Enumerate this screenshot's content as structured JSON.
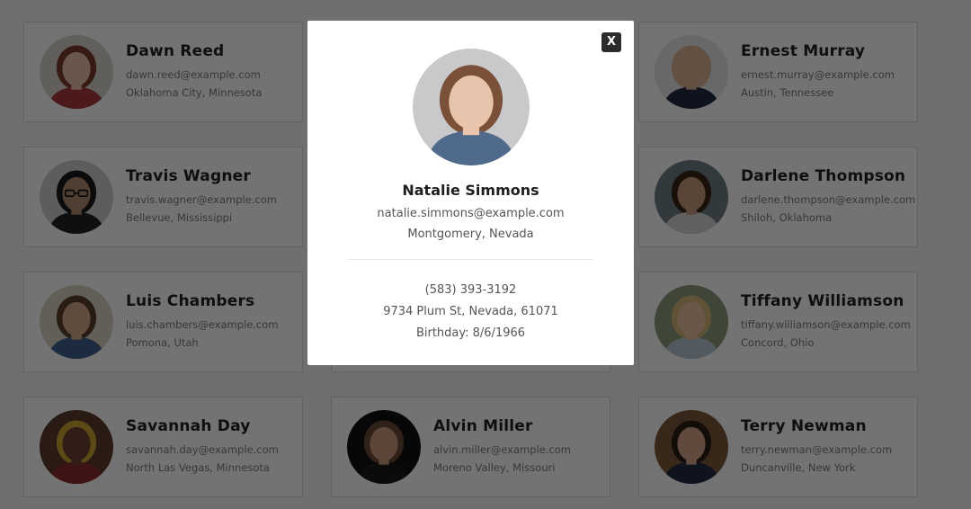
{
  "users": [
    {
      "name": "Dawn Reed",
      "email": "dawn.reed@example.com",
      "location": "Oklahoma City, Minnesota",
      "avatar": "woman-portrait",
      "bg": "#d8d2cc",
      "skin": "#e8c2a8",
      "hair": "#7a3b2a",
      "cloth": "#a83a3a"
    },
    {
      "name": "",
      "email": "",
      "location": "",
      "avatar": "hidden",
      "bg": "#dddddd",
      "skin": "#cccccc",
      "hair": "#999999",
      "cloth": "#aaaaaa"
    },
    {
      "name": "Ernest Murray",
      "email": "ernest.murray@example.com",
      "location": "Austin, Tennessee",
      "avatar": "man-portrait",
      "bg": "#e6e6e6",
      "skin": "#d9b196",
      "hair": "#d9b196",
      "cloth": "#1f2c44"
    },
    {
      "name": "Travis Wagner",
      "email": "travis.wagner@example.com",
      "location": "Bellevue, Mississippi",
      "avatar": "man-glasses-portrait",
      "bg": "#cfcfcf",
      "skin": "#b08a70",
      "hair": "#1a1a1a",
      "cloth": "#222222"
    },
    {
      "name": "",
      "email": "",
      "location": "",
      "avatar": "hidden",
      "bg": "#dddddd",
      "skin": "#cccccc",
      "hair": "#999999",
      "cloth": "#aaaaaa"
    },
    {
      "name": "Darlene Thompson",
      "email": "darlene.thompson@example.com",
      "location": "Shiloh, Oklahoma",
      "avatar": "woman-portrait",
      "bg": "#6f7f86",
      "skin": "#c89a7e",
      "hair": "#3b2418",
      "cloth": "#d8d8d8"
    },
    {
      "name": "Luis Chambers",
      "email": "luis.chambers@example.com",
      "location": "Pomona, Utah",
      "avatar": "man-portrait",
      "bg": "#d9d2c6",
      "skin": "#d6a98a",
      "hair": "#5a3e2c",
      "cloth": "#3f5f8f"
    },
    {
      "name": "",
      "email": "",
      "location": "",
      "avatar": "hidden",
      "bg": "#dddddd",
      "skin": "#cccccc",
      "hair": "#999999",
      "cloth": "#aaaaaa"
    },
    {
      "name": "Tiffany Williamson",
      "email": "tiffany.williamson@example.com",
      "location": "Concord, Ohio",
      "avatar": "woman-portrait",
      "bg": "#8d9a7a",
      "skin": "#e9c4a4",
      "hair": "#d6b77a",
      "cloth": "#b9c7d3"
    },
    {
      "name": "Savannah Day",
      "email": "savannah.day@example.com",
      "location": "North Las Vegas, Minnesota",
      "avatar": "woman-portrait",
      "bg": "#5b3a2a",
      "skin": "#6a4232",
      "hair": "#c9a332",
      "cloth": "#8a2a2a"
    },
    {
      "name": "Alvin Miller",
      "email": "alvin.miller@example.com",
      "location": "Moreno Valley, Missouri",
      "avatar": "man-portrait",
      "bg": "#111111",
      "skin": "#c99b7e",
      "hair": "#6b4a35",
      "cloth": "#1a1a1a"
    },
    {
      "name": "Terry Newman",
      "email": "terry.newman@example.com",
      "location": "Duncanville, New York",
      "avatar": "man-portrait",
      "bg": "#7a5a3a",
      "skin": "#d4a487",
      "hair": "#2a1e18",
      "cloth": "#1f2a44"
    }
  ],
  "modal": {
    "name": "Natalie Simmons",
    "email": "natalie.simmons@example.com",
    "location": "Montgomery, Nevada",
    "phone": "(583) 393-3192",
    "address": "9734 Plum St, Nevada, 61071",
    "birthday": "Birthday: 8/6/1966",
    "close_label": "X",
    "avatar": "woman-portrait",
    "bg": "#c9c9cc",
    "skin": "#e8c4ad",
    "hair": "#7a5038",
    "cloth": "#4f6a8a"
  },
  "colors": {
    "overlay": "rgba(0,0,0,0.55)",
    "card_border": "#d9d9d9",
    "close_button": "#2b2b2b"
  }
}
